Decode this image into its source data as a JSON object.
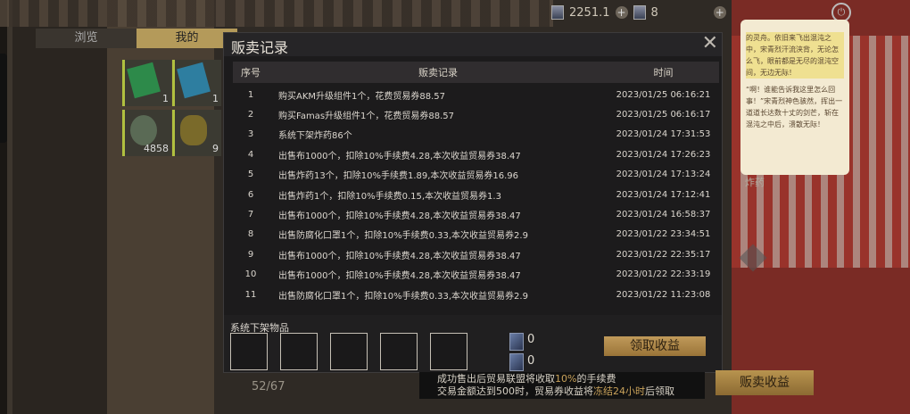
{
  "currency": {
    "coins": "2251.1",
    "tickets": "8"
  },
  "bg_tabs": [
    "浏览",
    "我的"
  ],
  "inventory": [
    {
      "count": "1",
      "color": "#2d8a4a"
    },
    {
      "count": "1",
      "color": "#2e7ea0"
    },
    {
      "count": "4858",
      "color": "#5a6a55"
    },
    {
      "count": "9",
      "color": "#7a6a2a"
    }
  ],
  "inventory_capacity": "52/67",
  "dialog": {
    "title": "贩卖记录",
    "columns": {
      "num": "序号",
      "record": "贩卖记录",
      "time": "时间"
    },
    "rows": [
      {
        "num": "1",
        "record": "购买AKM升级组件1个，花费贸易券88.57",
        "time": "2023/01/25 06:16:21"
      },
      {
        "num": "2",
        "record": "购买Famas升级组件1个，花费贸易券88.57",
        "time": "2023/01/25 06:16:17"
      },
      {
        "num": "3",
        "record": "系统下架炸药86个",
        "time": "2023/01/24 17:31:53"
      },
      {
        "num": "4",
        "record": "出售布1000个，扣除10%手续费4.28,本次收益贸易券38.47",
        "time": "2023/01/24 17:26:23"
      },
      {
        "num": "5",
        "record": "出售炸药13个，扣除10%手续费1.89,本次收益贸易券16.96",
        "time": "2023/01/24 17:13:24"
      },
      {
        "num": "6",
        "record": "出售炸药1个，扣除10%手续费0.15,本次收益贸易券1.3",
        "time": "2023/01/24 17:12:41"
      },
      {
        "num": "7",
        "record": "出售布1000个，扣除10%手续费4.28,本次收益贸易券38.47",
        "time": "2023/01/24 16:58:37"
      },
      {
        "num": "8",
        "record": "出售防腐化口罩1个，扣除10%手续费0.33,本次收益贸易券2.9",
        "time": "2023/01/22 23:34:51"
      },
      {
        "num": "9",
        "record": "出售布1000个，扣除10%手续费4.28,本次收益贸易券38.47",
        "time": "2023/01/22 22:35:17"
      },
      {
        "num": "10",
        "record": "出售布1000个，扣除10%手续费4.28,本次收益贸易券38.47",
        "time": "2023/01/22 22:33:19"
      },
      {
        "num": "11",
        "record": "出售防腐化口罩1个，扣除10%手续费0.33,本次收益贸易券2.9",
        "time": "2023/01/22 11:23:08"
      }
    ],
    "delist_label": "系统下架物品",
    "ticket_a": "0",
    "ticket_b": "0",
    "claim_label": "领取收益"
  },
  "notice": {
    "line1_pre": "成功售出后贸易联盟将收取",
    "line1_hl": "10%",
    "line1_post": "的手续费",
    "line2_pre": "交易金额达到500时，贸易券收益将",
    "line2_hl": "冻结24小时",
    "line2_post": "后领取"
  },
  "sell_income_label": "贩卖收益",
  "chat": {
    "p1": "的灵舟。依旧来飞出混沌之中，宋青烈汗流浃背，无论怎么飞，眼前都是无尽的混沌空间，无边无际！",
    "p2": "“啊！谁能告诉我这里怎么回事！”宋青烈神色骇然，挥出一道道长达数十丈的剑芒，斩在混沌之中后，溃散无际！"
  },
  "side_label": "炸药"
}
